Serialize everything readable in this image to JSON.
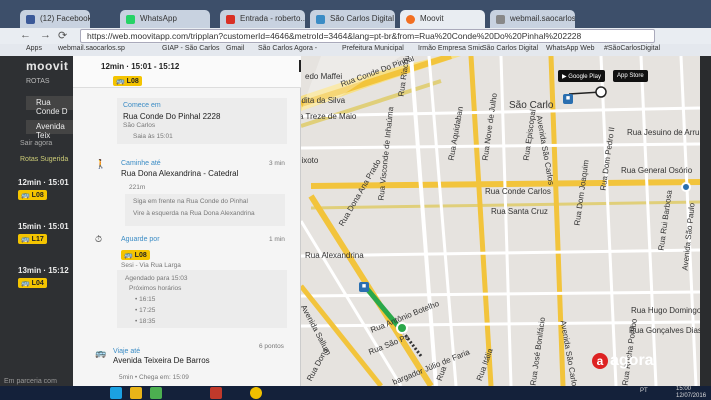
{
  "tabs": [
    {
      "label": "(12) Facebook",
      "color": "#3b5998"
    },
    {
      "label": "WhatsApp",
      "color": "#25d366"
    },
    {
      "label": "Entrada - roberto...",
      "color": "#d93025"
    },
    {
      "label": "São Carlos Digital",
      "color": "#3b8cc5"
    },
    {
      "label": "Moovit",
      "color": "#f26f21"
    },
    {
      "label": "webmail.saocarlos...",
      "color": "#888888"
    }
  ],
  "toolbar": {
    "url": "https://web.moovitapp.com/tripplan?customerId=4646&metroId=3464&lang=pt-br&from=Rua%20Conde%20Do%20Pinhal%202228"
  },
  "bookmarks": [
    "Apps",
    "webmail.saocarlos.sp",
    "GIAP - São Carlos",
    "Gmail",
    "São Carlos Agora -",
    "Prefeitura Municipal",
    "Irmão Empresa Smic",
    "São Carlos Digital",
    "WhatsApp Web",
    "#SãoCarlosDigital"
  ],
  "sidebar": {
    "brand": "moovit",
    "rotas": "ROTAS",
    "from": "Rua Conde D",
    "to": "Avenida Teix",
    "sair": "Sair agora",
    "sugestoes": "Rotas Sugerida",
    "routes": [
      {
        "time": "12min · 15:01",
        "line": "L08"
      },
      {
        "time": "15min · 15:01",
        "line": "L17"
      },
      {
        "time": "13min · 15:12",
        "line": "L04"
      }
    ],
    "partner": "Em parceria com"
  },
  "panel": {
    "header_time": "12min · 15:01 - 15:12",
    "header_line": "L08",
    "start_label": "Comece em",
    "start_place": "Rua Conde Do Pinhal 2228",
    "start_city": "São Carlos",
    "start_depart": "Saia às 15:01",
    "walk_label": "Caminhe até",
    "walk_dest": "Rua Dona Alexandrina - Catedral",
    "walk_duration": "3 min",
    "walk_distance": "221m",
    "walk_step1": "Siga em frente na Rua Conde do Pinhal",
    "walk_step2": "Vire à esquerda na Rua Dona Alexandrina",
    "wait_label": "Aguarde por",
    "wait_duration": "1 min",
    "wait_line": "L08",
    "wait_route": "Sesi - Via Rua Larga",
    "scheduled": "Agendado para 15:03",
    "next_label": "Próximos horários",
    "next_times": [
      "16:15",
      "17:25",
      "18:35"
    ],
    "ride_label": "Viaje até",
    "ride_dest": "Avenida Teixeira De Barros",
    "ride_stops": "6 pontos",
    "ride_arrive": "5min • Chega em: 15:09"
  },
  "map": {
    "streets": [
      {
        "name": "Rua Conde Do Pinhal",
        "rot": -20
      },
      {
        "name": "Rua Treze de Maio",
        "rot": -15
      },
      {
        "name": "Rua Conde Carlos",
        "rot": -3
      },
      {
        "name": "Rua Santa Cruz",
        "rot": -3
      },
      {
        "name": "Rua Aquidaban",
        "rot": -80
      },
      {
        "name": "Rua Riachuelo",
        "rot": -82
      },
      {
        "name": "Rua Episcopal",
        "rot": -82
      },
      {
        "name": "Avenida São Carlos",
        "rot": 80
      },
      {
        "name": "Rua Dom Pedro II",
        "rot": -82
      },
      {
        "name": "Rua General Osório",
        "rot": -3
      },
      {
        "name": "Rua Jesuino de Arruda",
        "rot": -3
      },
      {
        "name": "Rua Dona Ana Prado",
        "rot": -60
      },
      {
        "name": "Avenida São Carlos",
        "rot": 80
      },
      {
        "name": "Rua Rui Barbosa",
        "rot": -82
      },
      {
        "name": "Avenida São Paulo",
        "rot": -84
      },
      {
        "name": "Rua Antônio Botelho",
        "rot": -22
      },
      {
        "name": "Rua São Paulo",
        "rot": -22
      },
      {
        "name": "Rua Hugo Domingos",
        "rot": -3
      },
      {
        "name": "Rua Gonçalves",
        "rot": -3
      },
      {
        "name": "Rua Itália",
        "rot": -70
      },
      {
        "name": "Rua José Bonifácio",
        "rot": -82
      },
      {
        "name": "Rua Rocha Pombo",
        "rot": -82
      },
      {
        "name": "Avenida Sallum",
        "rot": -62
      },
      {
        "name": "Rua Alexandrina",
        "rot": -82
      },
      {
        "name": "Rua Visconde de Inhaúma",
        "rot": -84
      },
      {
        "name": "Rua Dona Maria",
        "rot": 0
      },
      {
        "name": "Rua Nove de Julho",
        "rot": -82
      },
      {
        "name": "Rua Dom Joaquim",
        "rot": -82
      },
      {
        "name": "Rua Desembargador Júlio de Faria",
        "rot": -22
      },
      {
        "name": "Avenida Sallum",
        "rot": -62
      }
    ],
    "street_texts": [
      "edo Maffei",
      "Rua Conde Do Pinhal",
      "edita da Silva",
      "a Treze de Maio",
      "eixoto",
      "Rua Riachuelo",
      "Rua Aquidaban",
      "Rua Episcopal",
      "Avenida São Carlos",
      "Rua Dom Pedro II",
      "Rua Jesuino de Arru",
      "Rua General Osório",
      "Rua Conde Carlos",
      "Rua Santa Cruz",
      "Rua Dona Ana Prado",
      "Rua Rui Barbosa",
      "Avenida São Paulo",
      "Rua Antônio Botelho",
      "Rua São Pa",
      "Rua Hugo Domingos",
      "Rua Gonçalves Dias",
      "Rua Itália",
      "Rua José Bonifácio",
      "Rua Rocha Pombo",
      "Avenida Sallum",
      "Rua Visconde de Inhaúma",
      "Rua Nove de Julho",
      "Rua Dom Joaquim",
      "Avenida São Carlos",
      "bargador Júlio de Faria",
      "Rua",
      "Rua Dona",
      "Rua Alexandrina"
    ],
    "city_label": "São Carlo",
    "google_play": "Google Play",
    "app_store": "App Store"
  },
  "taskbar": {
    "clock_time": "15:00",
    "clock_date": "12/07/2016",
    "lang": "PT"
  },
  "watermark": "agora",
  "colors": {
    "accent": "#3b8cc5",
    "bus": "#f4c400",
    "route": "#f2c43c"
  }
}
